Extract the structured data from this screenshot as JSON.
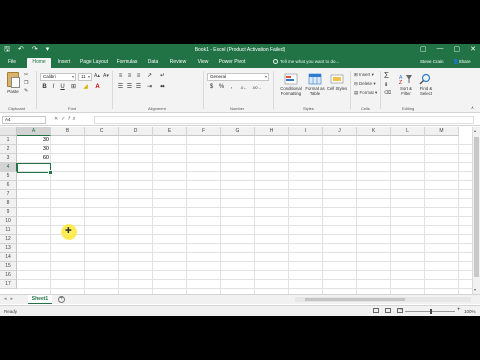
{
  "app": {
    "title": "Book1 - Excel (Product Activation Failed)",
    "accent": "#217346"
  },
  "qat": {
    "save_icon": "save-icon",
    "undo_icon": "undo-icon",
    "redo_icon": "redo-icon"
  },
  "window": {
    "ribbon_options": "▢",
    "minimize": "—",
    "restore": "▢",
    "close": "✕"
  },
  "tabs": [
    {
      "label": "File"
    },
    {
      "label": "Home",
      "active": true
    },
    {
      "label": "Insert"
    },
    {
      "label": "Page Layout"
    },
    {
      "label": "Formulas"
    },
    {
      "label": "Data"
    },
    {
      "label": "Review"
    },
    {
      "label": "View"
    },
    {
      "label": "Power Pivot"
    }
  ],
  "tell_me": "Tell me what you want to do...",
  "user": "Steve Crain",
  "share": "Share",
  "ribbon": {
    "paste_label": "Paste",
    "font_name": "Calibri",
    "font_size": "11",
    "number_format": "General",
    "bold": "B",
    "italic": "I",
    "underline": "U",
    "percent": "%",
    "comma": ",",
    "conditional_formatting": "Conditional Formatting",
    "format_as_table": "Format as Table",
    "cell_styles": "Cell Styles",
    "insert": "Insert",
    "delete": "Delete",
    "format": "Format",
    "sort_filter": "Sort & Filter",
    "find_select": "Find & Select",
    "groups": {
      "clipboard": "Clipboard",
      "font": "Font",
      "alignment": "Alignment",
      "number": "Number",
      "styles": "Styles",
      "cells": "Cells",
      "editing": "Editing"
    }
  },
  "formula_bar": {
    "name_box": "A4",
    "fx": "fx",
    "value": ""
  },
  "grid": {
    "columns": [
      "A",
      "B",
      "C",
      "D",
      "E",
      "F",
      "G",
      "H",
      "I",
      "J",
      "K",
      "L",
      "M"
    ],
    "rows": [
      "1",
      "2",
      "3",
      "4",
      "5",
      "6",
      "7",
      "8",
      "9",
      "10",
      "11",
      "12",
      "13",
      "14",
      "15",
      "16",
      "17"
    ],
    "cells": {
      "A1": "30",
      "A2": "30",
      "A3": "60"
    },
    "active_cell": "A4"
  },
  "sheets": [
    {
      "label": "Sheet1",
      "active": true
    }
  ],
  "status": {
    "ready": "Ready",
    "zoom": "100%"
  }
}
